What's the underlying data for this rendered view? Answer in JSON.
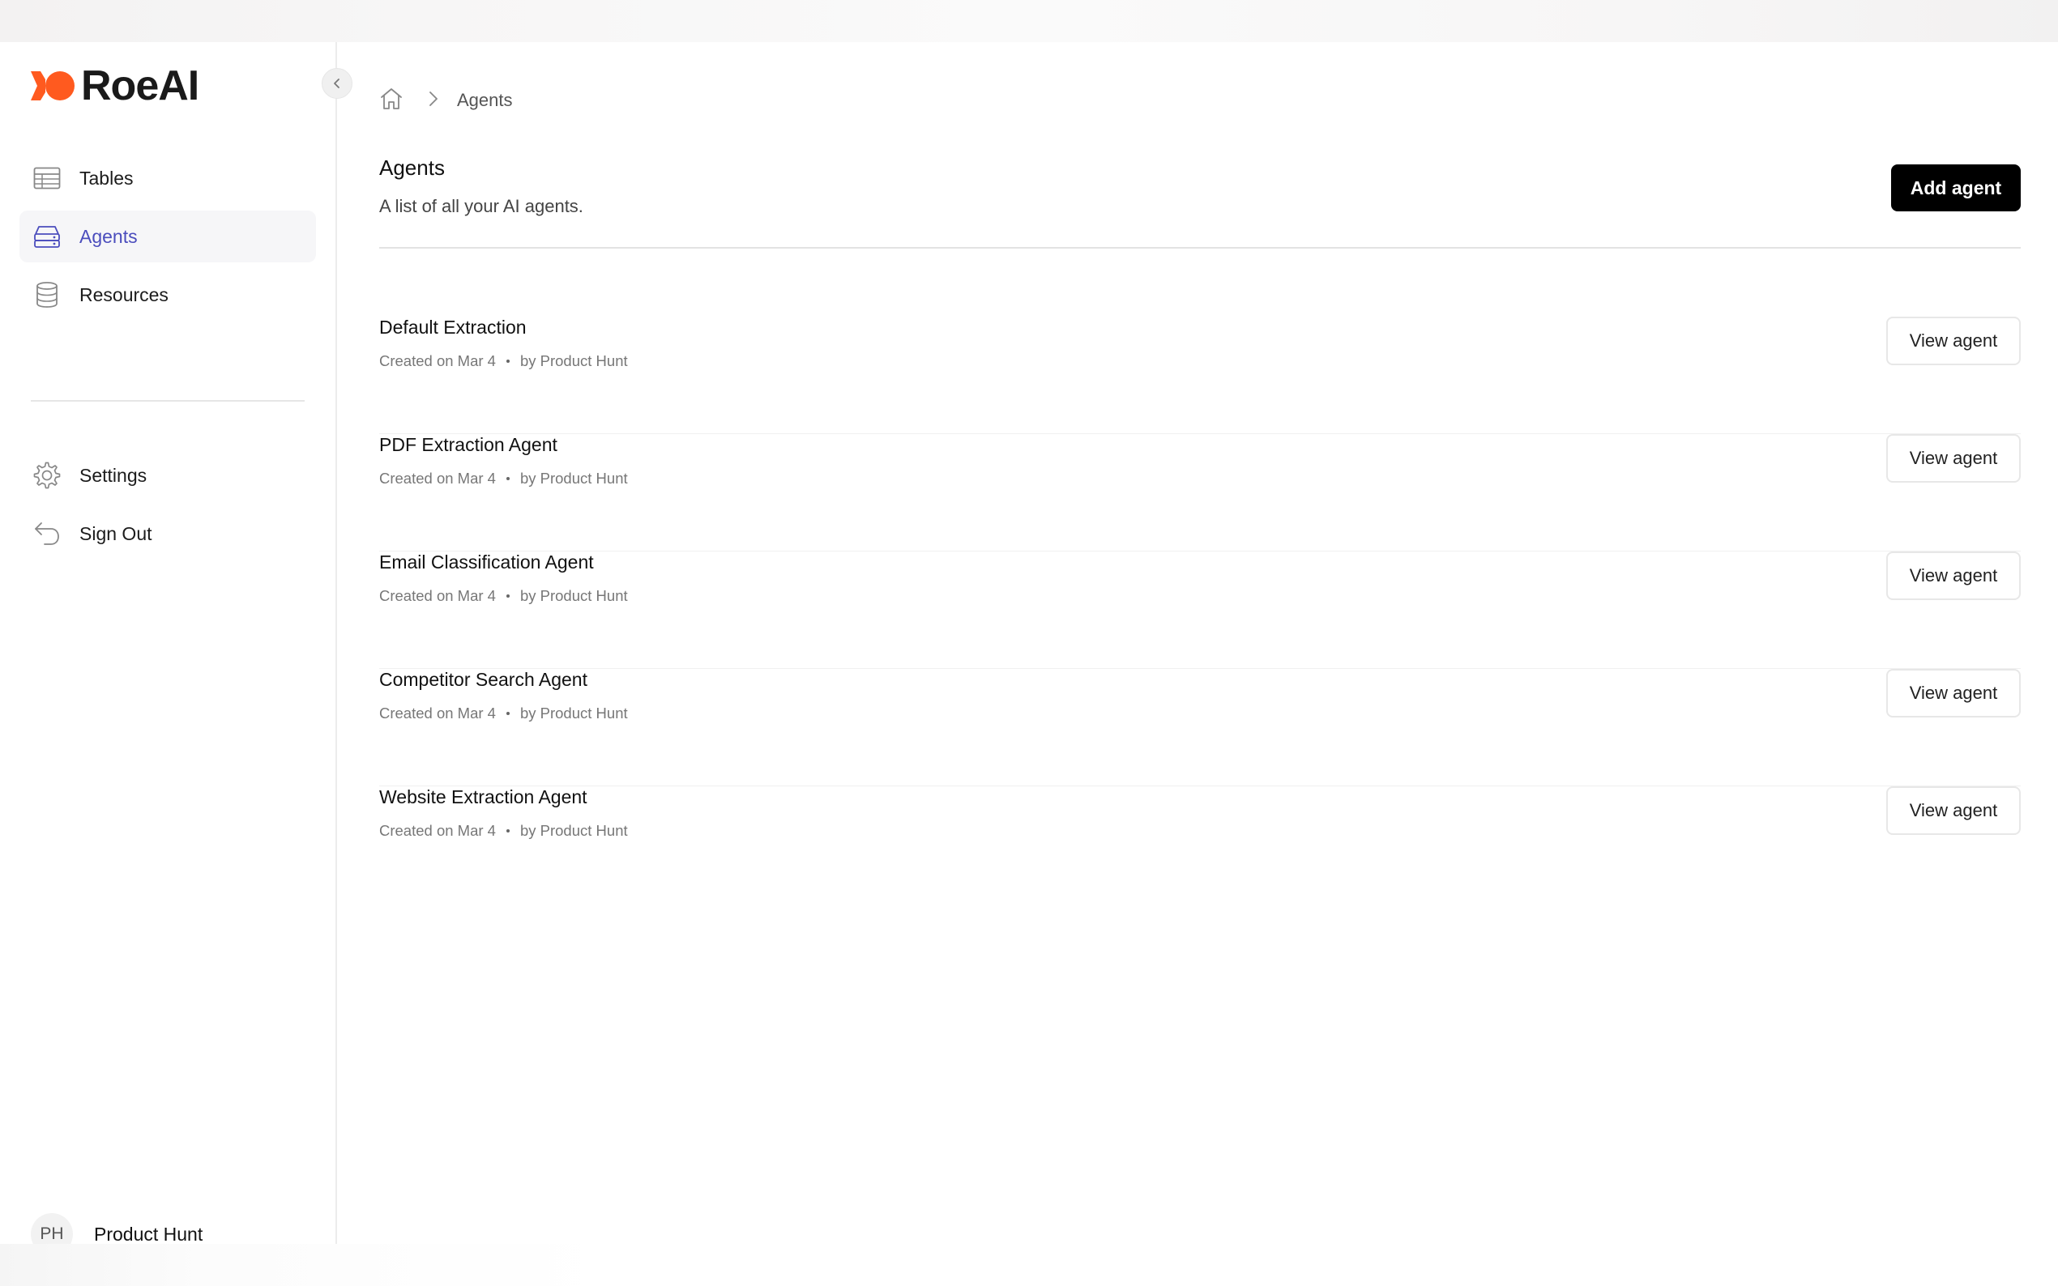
{
  "brand": {
    "name": "RoeAI",
    "accent": "#FF5A1F"
  },
  "sidebar": {
    "items": [
      {
        "label": "Tables",
        "icon": "table-icon",
        "active": false
      },
      {
        "label": "Agents",
        "icon": "agents-icon",
        "active": true
      },
      {
        "label": "Resources",
        "icon": "database-icon",
        "active": false
      }
    ],
    "secondary": [
      {
        "label": "Settings",
        "icon": "gear-icon"
      },
      {
        "label": "Sign Out",
        "icon": "sign-out-icon"
      }
    ],
    "user": {
      "initials": "PH",
      "name": "Product Hunt"
    },
    "active_color": "#4B4DBD"
  },
  "breadcrumb": {
    "current": "Agents"
  },
  "header": {
    "title": "Agents",
    "subtitle": "A list of all your AI agents.",
    "add_label": "Add agent"
  },
  "agents": [
    {
      "name": "Default Extraction",
      "created": "Created on Mar 4",
      "author": "by Product Hunt",
      "action": "View agent"
    },
    {
      "name": "PDF Extraction Agent",
      "created": "Created on Mar 4",
      "author": "by Product Hunt",
      "action": "View agent"
    },
    {
      "name": "Email Classification Agent",
      "created": "Created on Mar 4",
      "author": "by Product Hunt",
      "action": "View agent"
    },
    {
      "name": "Competitor Search Agent",
      "created": "Created on Mar 4",
      "author": "by Product Hunt",
      "action": "View agent"
    },
    {
      "name": "Website Extraction Agent",
      "created": "Created on Mar 4",
      "author": "by Product Hunt",
      "action": "View agent"
    }
  ]
}
